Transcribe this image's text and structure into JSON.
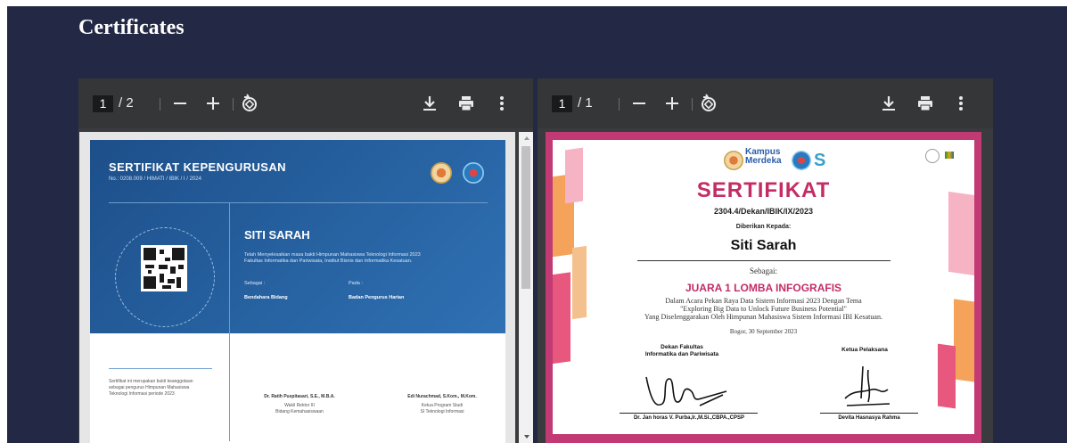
{
  "section": {
    "title": "Certificates"
  },
  "viewers": [
    {
      "page_current": "1",
      "page_total": "/ 2",
      "certificate": {
        "title": "SERTIFIKAT KEPENGURUSAN",
        "number": "No.: 0208.009 / HIMATI / IBIK / I / 2024",
        "name": "SITI SARAH",
        "description_1": "Telah Menyelesaikan masa bakti Himpunan Mahasiswa Teknologi Informasi 2023",
        "description_2": "Fakultas Informatika dan Pariwisata, Institut Bisnis dan Informatika Kesatuan.",
        "as_label": "Sebagai :",
        "as_value": "Bendahara Bidang",
        "at_label": "Pada :",
        "at_value": "Badan Pengurus Harian",
        "footnote_1": "Sertifikat ini merupakan bukti keanggotaan",
        "footnote_2": "sebagai pengurus Himpunan Mahasiswa",
        "footnote_3": "Teknologi Informasi periode 2023",
        "sign1_name": "Dr. Ratih Puspitasari, S.E., M.B.A.",
        "sign1_role1": "Wakil Rektor III",
        "sign1_role2": "Bidang Kemahasiswaan",
        "sign2_name": "Edi Nurachmad, S.Kom., M.Kom.",
        "sign2_role1": "Ketua Program Studi",
        "sign2_role2": "SI Teknologi Informasi"
      }
    },
    {
      "page_current": "1",
      "page_total": "/ 1",
      "certificate": {
        "brand": "Kampus Merdeka",
        "title": "SERTIFIKAT",
        "number": "2304.4/Dekan/IBIK/IX/2023",
        "given_to": "Diberikan Kepada:",
        "name": "Siti Sarah",
        "as_label": "Sebagai:",
        "award": "JUARA 1 LOMBA INFOGRAFIS",
        "desc_1": "Dalam Acara Pekan Raya Data Sistem Informasi 2023 Dengan Tema",
        "desc_2": "\"Exploring Big Data to Unlock Future Business Potential\"",
        "desc_3": "Yang Diselenggarakan Oleh Himpunan Mahasiswa Sistem Informasi IBI Kesatuan.",
        "place_date": "Bogor, 30 September 2023",
        "sign1_title_1": "Dekan Fakultas",
        "sign1_title_2": "Informatika dan Pariwisata",
        "sign2_title": "Ketua Pelaksana",
        "sign1_name": "Dr. Jan horas V. Purba,Ir.,M.Si.,CBPA.,CPSP",
        "sign2_name": "Devita Hasnasya Rahma"
      }
    }
  ],
  "colors": {
    "background": "#232845",
    "toolbar": "#343638",
    "accent_pink": "#c42c66",
    "cert_blue": "#2f71b4"
  },
  "icons": [
    "zoom-out-icon",
    "zoom-in-icon",
    "rotate-icon",
    "download-icon",
    "print-icon",
    "more-icon"
  ]
}
